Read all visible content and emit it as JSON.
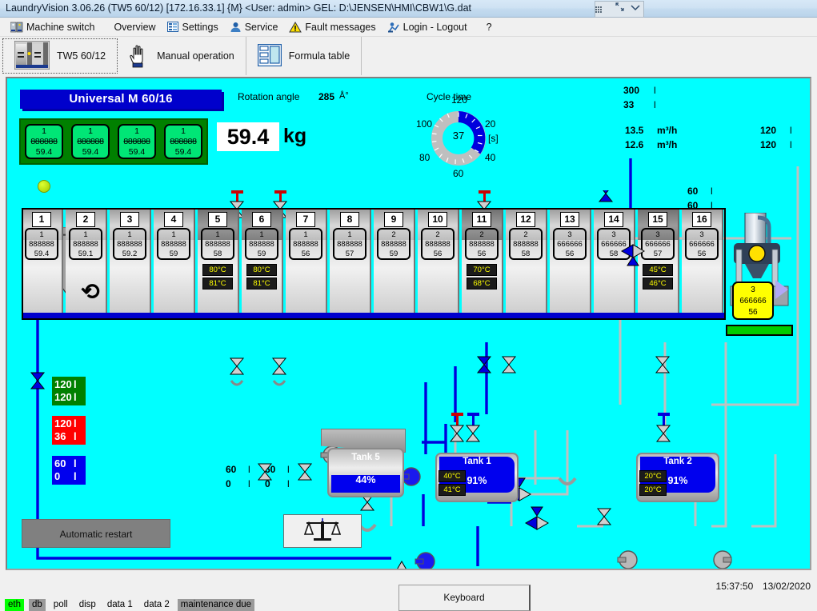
{
  "window": {
    "title": "LaundryVision 3.06.26 (TW5 60/12) [172.16.33.1] {M} <User: admin>   GEL: D:\\JENSEN\\HMI\\CBW1\\G.dat",
    "caption_buttons": [
      "grid-icon",
      "restore-icon",
      "chevron-down-icon"
    ]
  },
  "menu": {
    "items": [
      {
        "label": "Machine switch",
        "icon": "machine-icon"
      },
      {
        "label": "Overview",
        "icon": "none"
      },
      {
        "label": "Settings",
        "icon": "settings-icon"
      },
      {
        "label": "Service",
        "icon": "service-person-icon"
      },
      {
        "label": "Fault messages",
        "icon": "warning-icon"
      },
      {
        "label": "Login - Logout",
        "icon": "login-icon"
      },
      {
        "label": "?",
        "icon": "none"
      }
    ]
  },
  "toolbar": {
    "tabs": [
      {
        "label": "TW5 60/12",
        "icon": "machine-thumbnail-icon",
        "active": true
      },
      {
        "label": "Manual operation",
        "icon": "hand-icon",
        "active": false
      },
      {
        "label": "Formula table",
        "icon": "table-icon",
        "active": false
      }
    ]
  },
  "mimic": {
    "machine_title": "Universal M 60/16",
    "queue": [
      {
        "line": "1",
        "code": "888888",
        "weight": "59.4",
        "color": "green"
      },
      {
        "line": "1",
        "code": "888888",
        "weight": "59.4",
        "color": "green"
      },
      {
        "line": "1",
        "code": "888888",
        "weight": "59.4",
        "color": "green"
      },
      {
        "line": "1",
        "code": "888888",
        "weight": "59.4",
        "color": "green"
      }
    ],
    "weight": {
      "value": "59.4",
      "unit": "kg"
    },
    "rotation": {
      "label": "Rotation angle",
      "value": "285",
      "unit": "Å°"
    },
    "cycle": {
      "label": "Cycle time",
      "value": "37",
      "unit": "[s]",
      "ticks": [
        "120",
        "20",
        "40",
        "60",
        "80",
        "100"
      ]
    },
    "compartments": [
      {
        "no": "1",
        "line": "1",
        "code": "888888",
        "weight": "59.4",
        "color": "green",
        "dark": false,
        "temps": []
      },
      {
        "no": "2",
        "line": "1",
        "code": "888888",
        "weight": "59.1",
        "color": "green",
        "dark": false,
        "temps": []
      },
      {
        "no": "3",
        "line": "1",
        "code": "888888",
        "weight": "59.2",
        "color": "green",
        "dark": false,
        "temps": []
      },
      {
        "no": "4",
        "line": "1",
        "code": "888888",
        "weight": "59",
        "color": "green",
        "dark": false,
        "temps": []
      },
      {
        "no": "5",
        "line": "1",
        "code": "888888",
        "weight": "58",
        "color": "green",
        "dark": true,
        "temps": [
          "80°C",
          "81°C"
        ]
      },
      {
        "no": "6",
        "line": "1",
        "code": "888888",
        "weight": "59",
        "color": "green",
        "dark": true,
        "temps": [
          "80°C",
          "81°C"
        ]
      },
      {
        "no": "7",
        "line": "1",
        "code": "888888",
        "weight": "56",
        "color": "green",
        "dark": false,
        "temps": []
      },
      {
        "no": "8",
        "line": "1",
        "code": "888888",
        "weight": "57",
        "color": "green",
        "dark": false,
        "temps": []
      },
      {
        "no": "9",
        "line": "2",
        "code": "888888",
        "weight": "59",
        "color": "magenta",
        "dark": false,
        "temps": []
      },
      {
        "no": "10",
        "line": "2",
        "code": "888888",
        "weight": "56",
        "color": "magenta",
        "dark": false,
        "temps": []
      },
      {
        "no": "11",
        "line": "2",
        "code": "888888",
        "weight": "56",
        "color": "magenta",
        "dark": true,
        "temps": [
          "70°C",
          "68°C"
        ]
      },
      {
        "no": "12",
        "line": "2",
        "code": "888888",
        "weight": "58",
        "color": "magenta",
        "dark": false,
        "temps": []
      },
      {
        "no": "13",
        "line": "3",
        "code": "666666",
        "weight": "56",
        "color": "yellow",
        "dark": false,
        "temps": []
      },
      {
        "no": "14",
        "line": "3",
        "code": "666666",
        "weight": "58",
        "color": "yellow",
        "dark": false,
        "temps": []
      },
      {
        "no": "15",
        "line": "3",
        "code": "666666",
        "weight": "57",
        "color": "yellow",
        "dark": true,
        "temps": [
          "45°C",
          "46°C"
        ]
      },
      {
        "no": "16",
        "line": "3",
        "code": "666666",
        "weight": "56",
        "color": "yellow",
        "dark": false,
        "temps": []
      }
    ],
    "press_batch": {
      "line": "3",
      "code": "666666",
      "weight": "56"
    },
    "readouts": {
      "top_volume_1": "300",
      "top_volume_1_unit": "l",
      "top_volume_2": "33",
      "top_volume_2_unit": "l",
      "flow_1": "13.5",
      "flow_1_unit": "m³/h",
      "flow_2": "12.6",
      "flow_2_unit": "m³/h",
      "right_volume_1": "120",
      "right_volume_1_unit": "l",
      "right_volume_2": "120",
      "right_volume_2_unit": "l",
      "mid_volume_1": "60",
      "mid_volume_1_unit": "l",
      "mid_volume_2": "60",
      "mid_volume_2_unit": "l",
      "bottom_a_1": "60",
      "bottom_a_2": "0",
      "bottom_b_1": "60",
      "bottom_b_2": "0",
      "unit_l": "l"
    },
    "flow_boxes": [
      {
        "top": "120",
        "bottom": "120",
        "unit": "l",
        "color": "green"
      },
      {
        "top": "120",
        "bottom": "36",
        "unit": "l",
        "color": "red"
      },
      {
        "top": "60",
        "bottom": "0",
        "unit": "l",
        "color": "blue"
      }
    ],
    "tanks": [
      {
        "name": "Tank 5",
        "level": "44%",
        "pct": 44,
        "temps": []
      },
      {
        "name": "Tank 1",
        "level": "91%",
        "pct": 91,
        "temps": [
          "40°C",
          "41°C"
        ]
      },
      {
        "name": "Tank 2",
        "level": "91%",
        "pct": 91,
        "temps": [
          "20°C",
          "20°C"
        ]
      }
    ],
    "auto_restart_label": "Automatic restart",
    "scale_button_icon": "scale-icon"
  },
  "footer": {
    "keyboard_label": "Keyboard",
    "time": "15:37:50",
    "date": "13/02/2020",
    "status": [
      {
        "label": "eth",
        "state": "on"
      },
      {
        "label": "db",
        "state": "gray"
      },
      {
        "label": "poll",
        "state": "plain"
      },
      {
        "label": "disp",
        "state": "plain"
      },
      {
        "label": "data 1",
        "state": "plain"
      },
      {
        "label": "data 2",
        "state": "plain"
      },
      {
        "label": "maintenance due",
        "state": "gray"
      }
    ]
  },
  "colors": {
    "mimic_bg": "#00ffff",
    "title_blue": "#0000cc",
    "green_batch": "#00e676",
    "magenta_batch": "#ff00ff",
    "yellow_batch": "#ffff00",
    "pipe_blue": "#0000dd",
    "pipe_gray": "#c0c0c0"
  }
}
